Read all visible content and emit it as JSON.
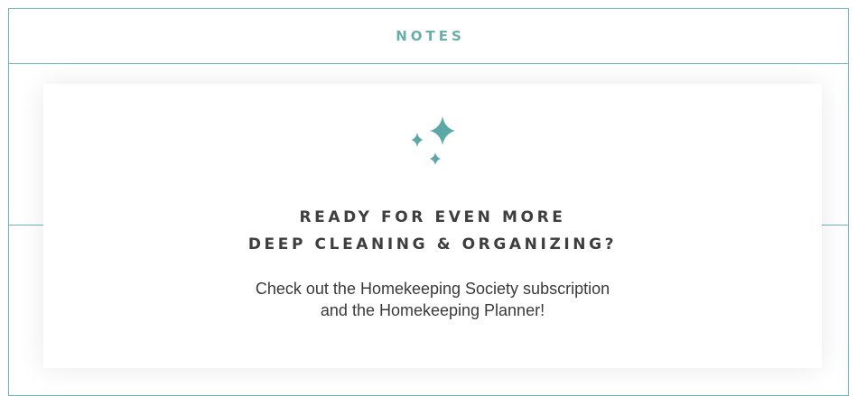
{
  "notes": {
    "title": "NOTES"
  },
  "promo": {
    "icon": "sparkle-icon",
    "heading_line_1": "READY FOR EVEN MORE",
    "heading_line_2": "DEEP CLEANING & ORGANIZING?",
    "body_line_1": "Check out the Homekeeping Society subscription",
    "body_line_2": "and the Homekeeping Planner!"
  },
  "colors": {
    "accent": "#6aaeab",
    "text": "#3e3e40",
    "background": "#ffffff"
  }
}
